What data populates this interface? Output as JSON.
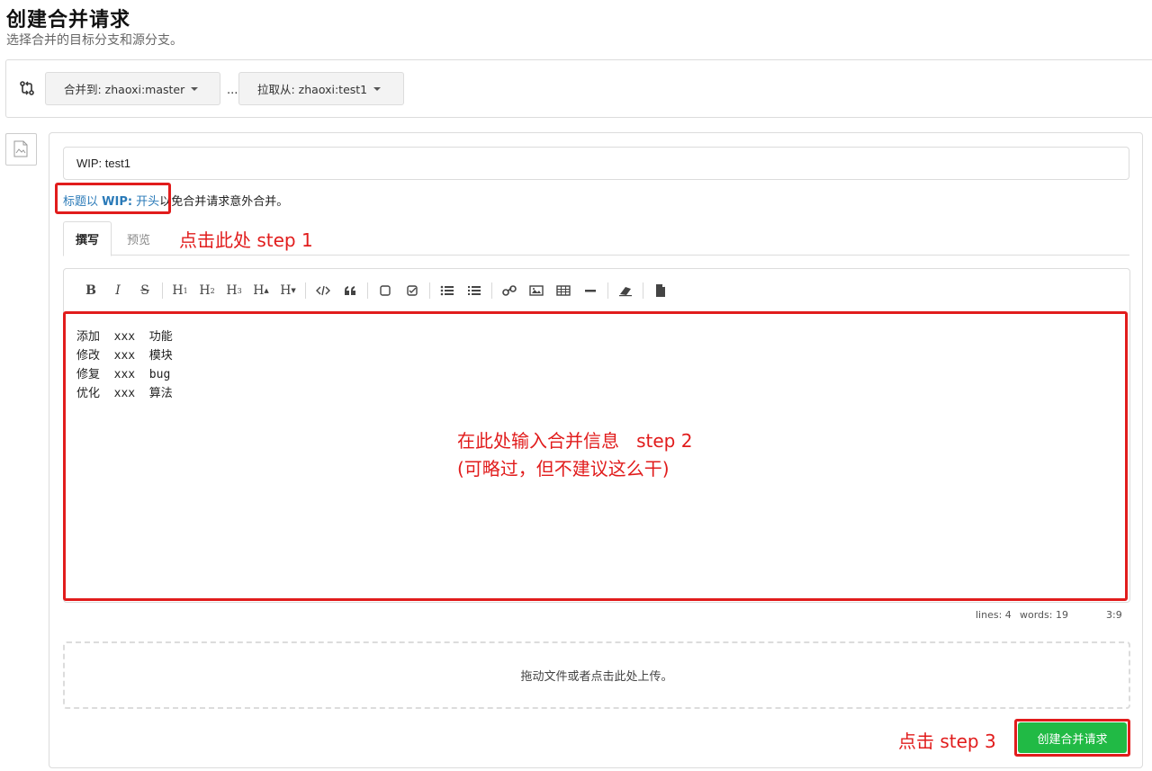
{
  "page": {
    "title": "创建合并请求",
    "subtitle": "选择合并的目标分支和源分支。"
  },
  "branches": {
    "target_label": "合并到: zhaoxi:master",
    "separator": "...",
    "source_label": "拉取从: zhaoxi:test1"
  },
  "form": {
    "title_value": "WIP: test1",
    "wip_hint_prefix": "标题以 ",
    "wip_hint_bold": "WIP:",
    "wip_hint_link_tail": " 开头",
    "wip_hint_suffix": "以免合并请求意外合并。"
  },
  "tabs": [
    {
      "label": "撰写",
      "active": true
    },
    {
      "label": "预览",
      "active": false
    }
  ],
  "toolbar": {
    "buttons": [
      "bold",
      "italic",
      "strikethrough",
      "heading-1",
      "heading-2",
      "heading-3",
      "heading-bigger",
      "heading-smaller",
      "code",
      "quote",
      "checkbox-empty",
      "checkbox-checked",
      "unordered-list",
      "ordered-list",
      "link",
      "image",
      "table",
      "horizontal-rule",
      "clean-block",
      "file"
    ],
    "labels": {
      "bold": "B",
      "italic": "I",
      "strike": "S",
      "h1": "H",
      "h1_sub": "1",
      "h2": "H",
      "h2_sub": "2",
      "h3": "H",
      "h3_sub": "3",
      "hb": "H",
      "hb_sub": "▲",
      "hs": "H",
      "hs_sub": "▼"
    }
  },
  "editor": {
    "lines": [
      "添加  xxx  功能",
      "修改  xxx  模块",
      "修复  xxx  bug",
      "优化  xxx  算法"
    ]
  },
  "status": {
    "lines": "lines: 4",
    "words": "words: 19",
    "cursor": "3:9"
  },
  "upload": {
    "text": "拖动文件或者点击此处上传。"
  },
  "submit": {
    "label": "创建合并请求"
  },
  "annotations": {
    "step1": "点击此处 step 1",
    "step2": "在此处输入合并信息   step 2\n(可略过，但不建议这么干)",
    "step3": "点击 step 3"
  },
  "colors": {
    "annotation": "#e11c1c",
    "submit": "#21ba45",
    "link": "#2a7ab8"
  }
}
